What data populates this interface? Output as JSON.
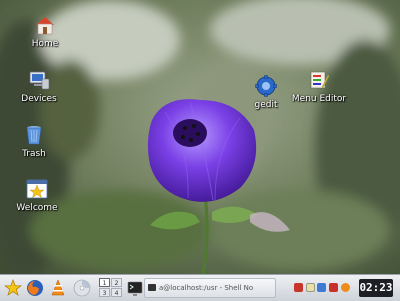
{
  "desktop": {
    "icons": [
      {
        "label": "Home"
      },
      {
        "label": "Devices"
      },
      {
        "label": "Trash"
      },
      {
        "label": "Welcome"
      },
      {
        "label": "gedit"
      },
      {
        "label": "Menu Editor"
      }
    ]
  },
  "taskbar": {
    "pager": [
      "1",
      "2",
      "3",
      "4"
    ],
    "active_workspace": "1",
    "tasks": [
      {
        "label": "a@localhost:/usr - Shell No",
        "icon": "terminal-icon"
      }
    ],
    "launchers": [
      "kde-menu-icon",
      "firefox-icon",
      "vlc-icon",
      "disc-icon",
      "terminal-icon"
    ],
    "tray": [
      "network-icon",
      "clipboard-icon",
      "klipper-icon",
      "kmix-icon",
      "battery-icon",
      "volume-icon"
    ],
    "clock": "02:23"
  },
  "colors": {
    "panel_top": "#eef0f3",
    "panel_bottom": "#cdd2d9",
    "flower": "#6a2fd0",
    "clock_bg": "#1d1f24"
  }
}
